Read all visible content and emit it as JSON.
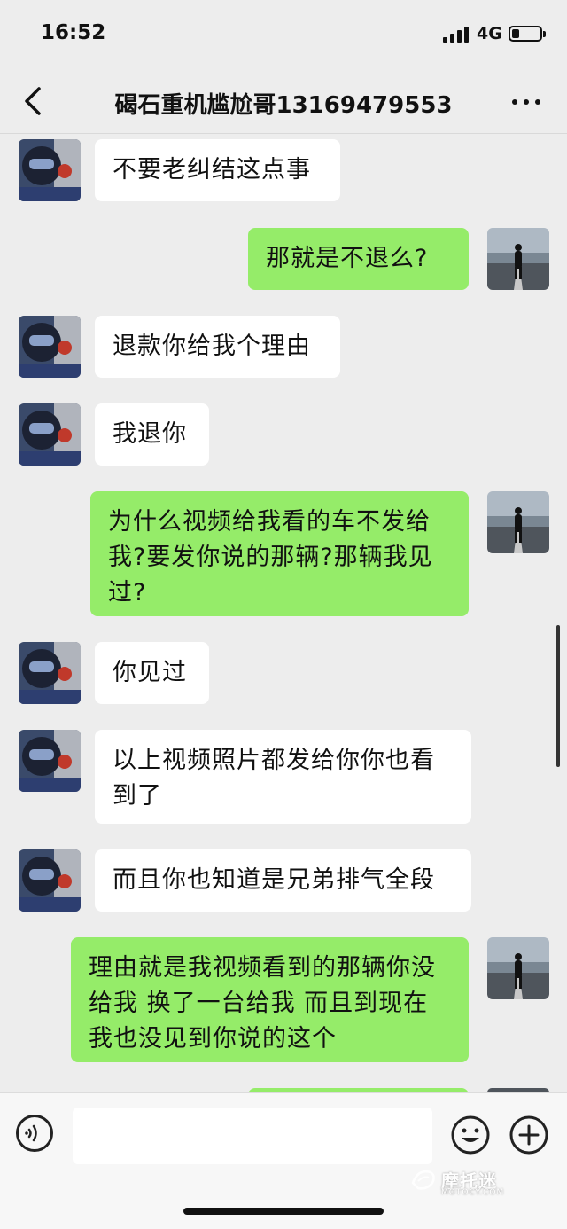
{
  "status": {
    "time": "16:52",
    "network": "4G",
    "battery_level_fraction": 0.25
  },
  "nav": {
    "title": "碣石重机尴尬哥13169479553",
    "back_icon": "chevron-left-icon",
    "more_icon": "more-dots-icon"
  },
  "messages": [
    {
      "side": "left",
      "text": "不要老纠结这点事"
    },
    {
      "side": "right",
      "text": "那就是不退么?"
    },
    {
      "side": "left",
      "text": "退款你给我个理由"
    },
    {
      "side": "left",
      "text": "我退你"
    },
    {
      "side": "right",
      "text": "为什么视频给我看的车不发给我?要发你说的那辆?那辆我见过?"
    },
    {
      "side": "left",
      "text": "你见过"
    },
    {
      "side": "left",
      "text": "以上视频照片都发给你你也看到了"
    },
    {
      "side": "left",
      "text": "而且你也知道是兄弟排气全段"
    },
    {
      "side": "right",
      "text": "理由就是我视频看到的那辆你没给我 换了一台给我 而且到现在我也没见到你说的这个"
    }
  ],
  "input": {
    "voice_icon": "voice-icon",
    "emoji_icon": "emoji-icon",
    "plus_icon": "plus-icon"
  },
  "watermark": {
    "main": "摩托迷",
    "sub": "MOTOCY.COM"
  },
  "colors": {
    "background": "#ededed",
    "bubble_self": "#95ec69",
    "bubble_other": "#ffffff"
  }
}
